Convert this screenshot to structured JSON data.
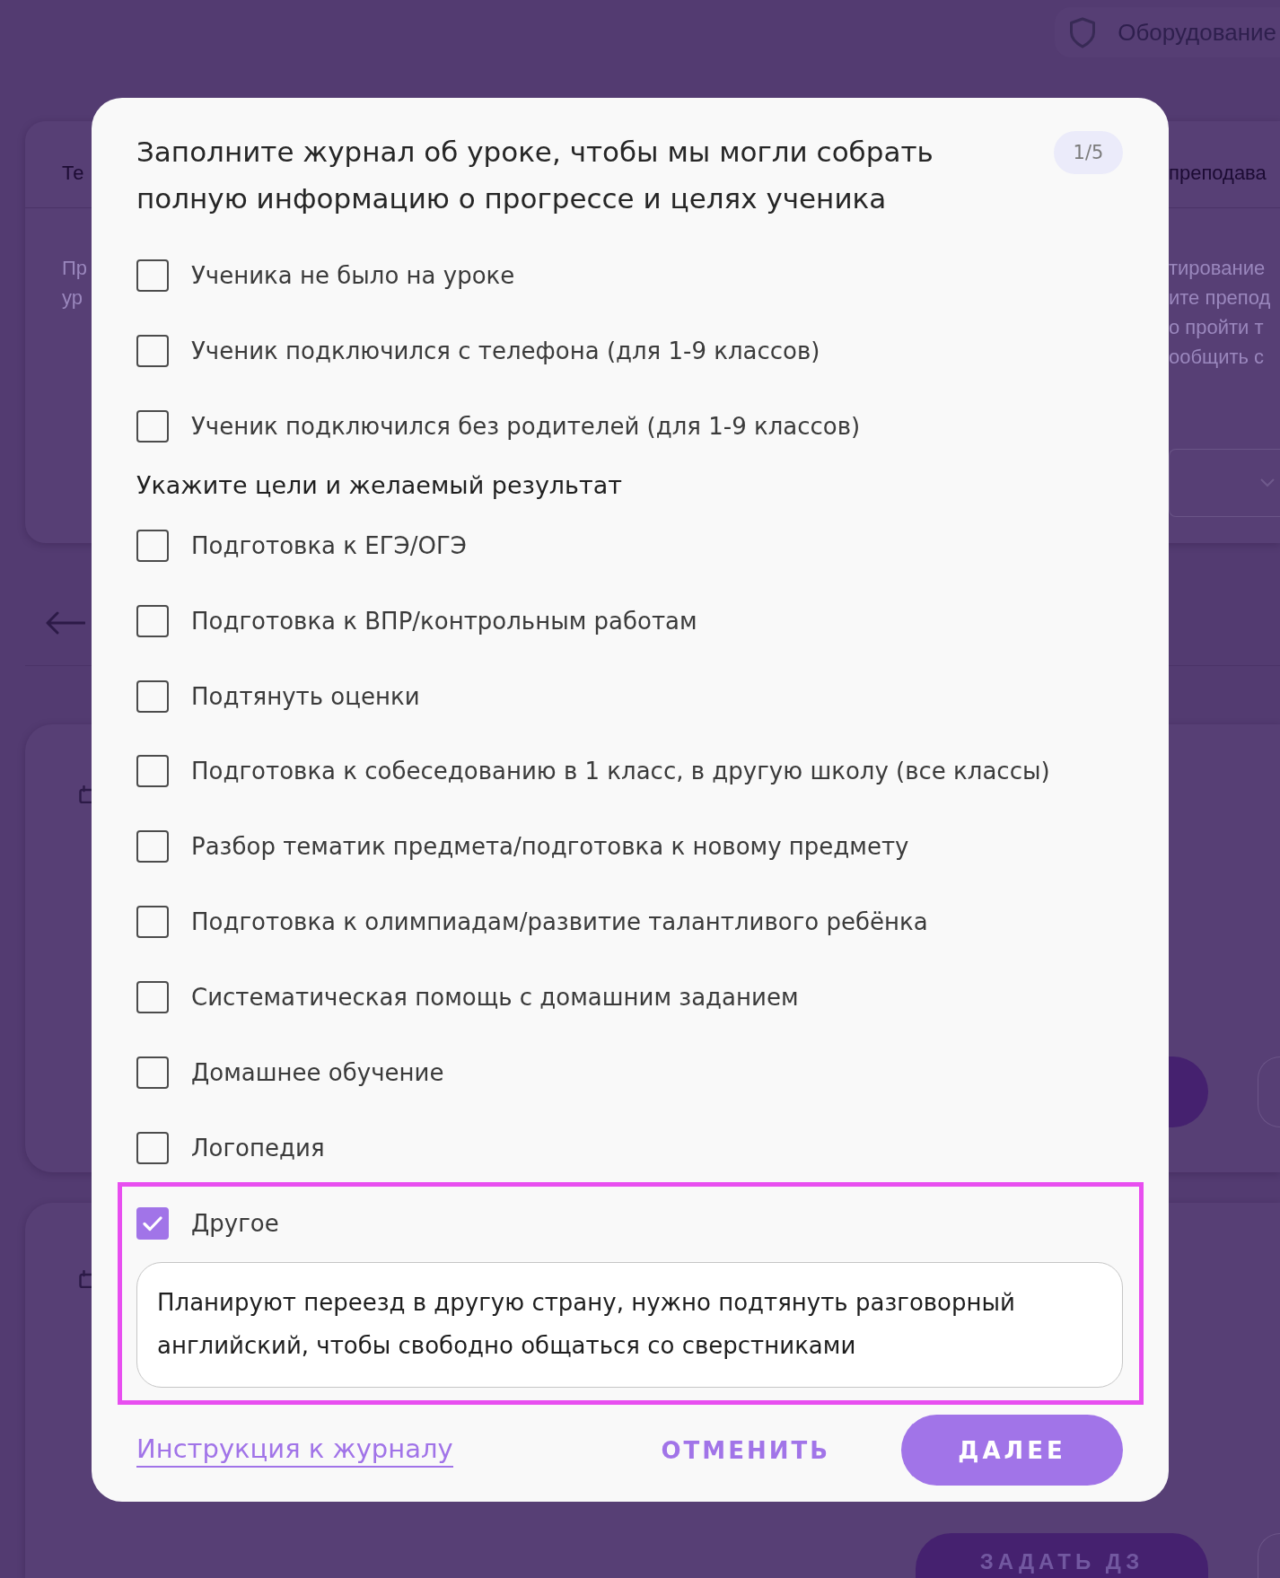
{
  "background_page": {
    "equipment_label": "Оборудование",
    "lesson_card": {
      "header_left": "Те",
      "header_right": "преподава",
      "left_lines": [
        "Пр",
        "ур"
      ],
      "right_lines": [
        "тирование",
        "ите препод",
        "о пройти т",
        "ообщить с"
      ]
    },
    "lessons": [
      {
        "kind": "hidden_action"
      },
      {
        "kind": "labeled_action",
        "action_label": "ЗАДАТЬ ДЗ"
      }
    ]
  },
  "dialog": {
    "title": "Заполните журнал об уроке, чтобы мы могли собрать полную информацию о прогрессе и целях ученика",
    "step": "1/5",
    "groups": [
      {
        "items": [
          {
            "label": "Ученика не было на уроке",
            "checked": false
          },
          {
            "label": "Ученик подключился с телефона (для 1-9 классов)",
            "checked": false
          },
          {
            "label": "Ученик подключился без родителей (для 1-9 классов)",
            "checked": false
          }
        ]
      },
      {
        "heading": "Укажите цели и желаемый результат",
        "items": [
          {
            "label": "Подготовка к ЕГЭ/ОГЭ",
            "checked": false
          },
          {
            "label": "Подготовка к ВПР/контрольным работам",
            "checked": false
          },
          {
            "label": "Подтянуть оценки",
            "checked": false
          },
          {
            "label": "Подготовка к собеседованию в 1 класс, в другую школу (все классы)",
            "checked": false
          },
          {
            "label": "Разбор тематик предмета/подготовка к новому предмету",
            "checked": false
          },
          {
            "label": "Подготовка к олимпиадам/развитие талантливого ребёнка",
            "checked": false
          },
          {
            "label": "Систематическая помощь с домашним заданием",
            "checked": false
          },
          {
            "label": "Домашнее обучение",
            "checked": false
          },
          {
            "label": "Логопедия",
            "checked": false
          },
          {
            "label": "Другое",
            "checked": true,
            "highlighted": true,
            "comment": "Планируют переезд в другую страну, нужно подтянуть разговорный английский, чтобы свободно общаться со сверстниками"
          }
        ]
      }
    ],
    "footer": {
      "link": "Инструкция к журналу",
      "cancel": "ОТМЕНИТЬ",
      "next": "ДАЛЕЕ"
    }
  }
}
